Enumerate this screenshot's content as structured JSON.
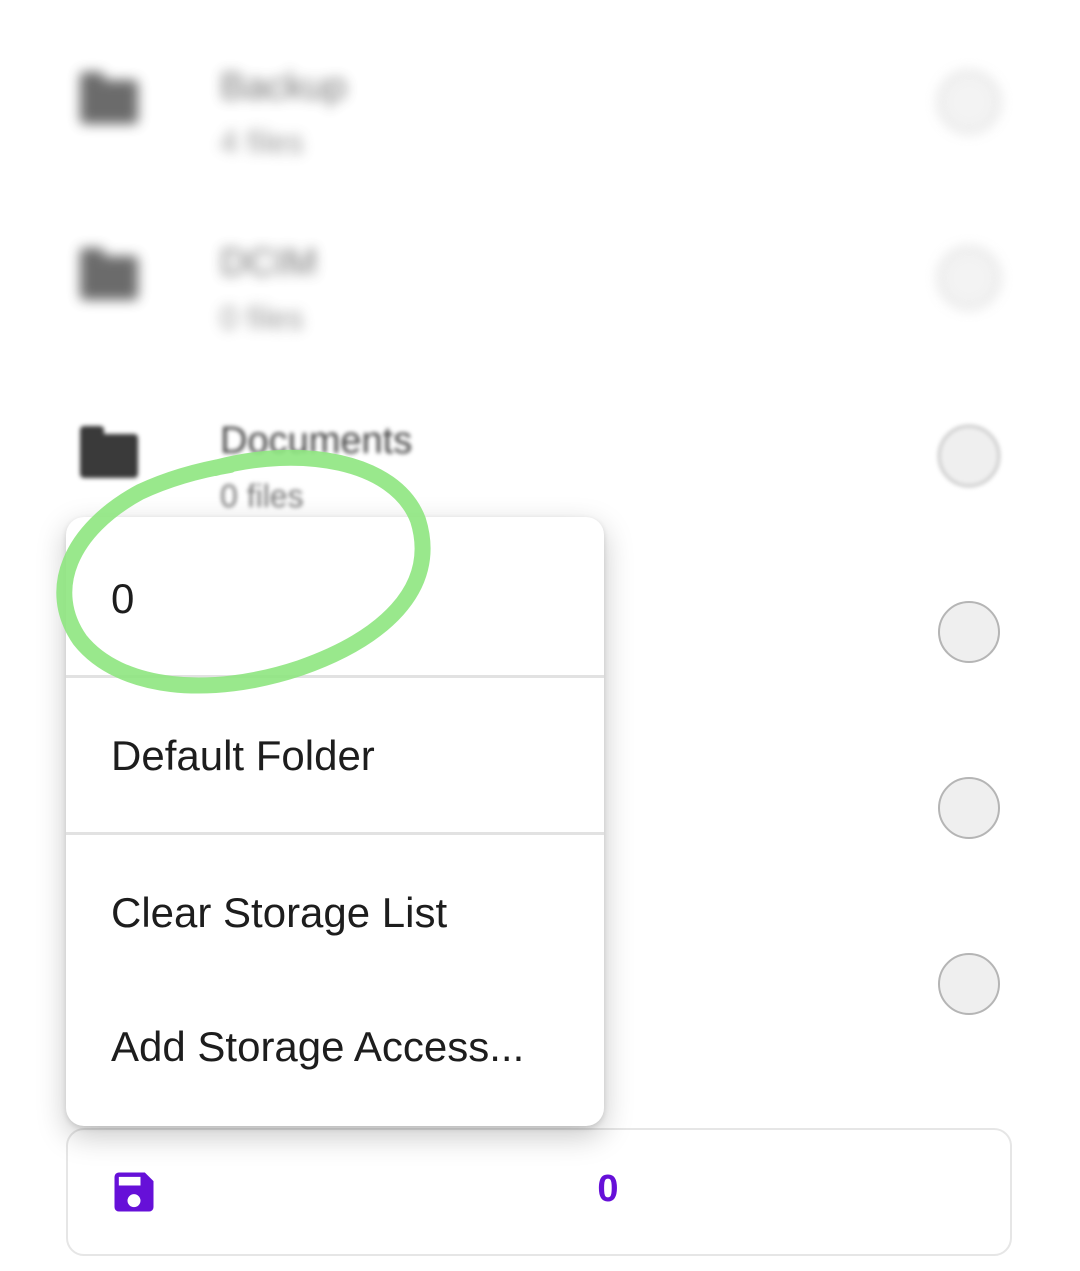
{
  "folders": [
    {
      "name": "Backup",
      "count": "4 files"
    },
    {
      "name": "DCIM",
      "count": "0 files"
    },
    {
      "name": "Documents",
      "count": "0 files"
    }
  ],
  "menu": {
    "items": [
      {
        "label": "0"
      },
      {
        "label": "Default Folder"
      },
      {
        "label": "Clear Storage List"
      },
      {
        "label": "Add Storage Access..."
      }
    ]
  },
  "storage_bar": {
    "icon": "floppy-disk-save-icon",
    "value": "0"
  },
  "colors": {
    "accent": "#6610d8",
    "highlight": "#8ee57f",
    "radio_fill": "#efefef",
    "radio_border": "#b5b5b5"
  }
}
